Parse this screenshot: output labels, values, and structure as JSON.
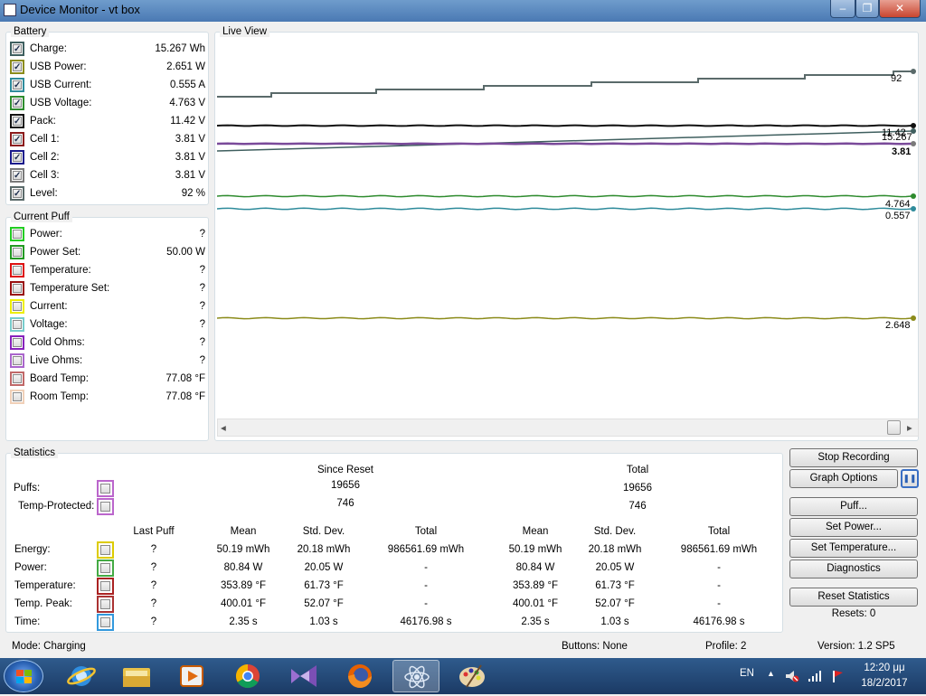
{
  "window": {
    "title": "Device Monitor - vt box",
    "min_icon": "–",
    "max_icon": "❐",
    "close_icon": "✕"
  },
  "battery": {
    "title": "Battery",
    "rows": [
      {
        "label": "Charge:",
        "value": "15.267 Wh",
        "color": "#3f5f5f",
        "checked": true
      },
      {
        "label": "USB Power:",
        "value": "2.651 W",
        "color": "#8b8b1a",
        "checked": true
      },
      {
        "label": "USB Current:",
        "value": "0.555 A",
        "color": "#2e8b9b",
        "checked": true
      },
      {
        "label": "USB Voltage:",
        "value": "4.763 V",
        "color": "#2e8b2e",
        "checked": true
      },
      {
        "label": "Pack:",
        "value": "11.42 V",
        "color": "#111111",
        "checked": true
      },
      {
        "label": "Cell 1:",
        "value": "3.81 V",
        "color": "#8b1a1a",
        "checked": true
      },
      {
        "label": "Cell 2:",
        "value": "3.81 V",
        "color": "#1a1a8b",
        "checked": true
      },
      {
        "label": "Cell 3:",
        "value": "3.81 V",
        "color": "#7a7a7a",
        "checked": true
      },
      {
        "label": "Level:",
        "value": "92 %",
        "color": "#5a6a6a",
        "checked": true
      }
    ]
  },
  "puff": {
    "title": "Current Puff",
    "rows": [
      {
        "label": "Power:",
        "value": "?",
        "color": "#22cc22",
        "checked": false
      },
      {
        "label": "Power Set:",
        "value": "50.00 W",
        "color": "#229922",
        "checked": false
      },
      {
        "label": "Temperature:",
        "value": "?",
        "color": "#dd1111",
        "checked": false
      },
      {
        "label": "Temperature Set:",
        "value": "?",
        "color": "#991111",
        "checked": false
      },
      {
        "label": "Current:",
        "value": "?",
        "color": "#eeee00",
        "checked": false
      },
      {
        "label": "Voltage:",
        "value": "?",
        "color": "#77cccc",
        "checked": false
      },
      {
        "label": "Cold Ohms:",
        "value": "?",
        "color": "#8822bb",
        "checked": false
      },
      {
        "label": "Live Ohms:",
        "value": "?",
        "color": "#aa66cc",
        "checked": false
      },
      {
        "label": "Board Temp:",
        "value": "77.08 °F",
        "color": "#c06868",
        "checked": false
      },
      {
        "label": "Room Temp:",
        "value": "77.08 °F",
        "color": "#f0d0b8",
        "checked": false
      }
    ]
  },
  "live_view": {
    "title": "Live View",
    "scroll_left": "◂",
    "scroll_right": "▸",
    "labels": [
      "92",
      "11.42",
      "15.267",
      "3.81",
      "4.764",
      "0.557",
      "2.648"
    ]
  },
  "statistics": {
    "title": "Statistics",
    "since_reset": "Since Reset",
    "total": "Total",
    "puffs_label": "Puffs:",
    "puffs_color": "#bb66cc",
    "puffs_since": "19656",
    "puffs_total": "19656",
    "temp_label": "Temp-Protected:",
    "temp_color": "#bb66cc",
    "temp_since": "746",
    "temp_total": "746",
    "columns": [
      "Last Puff",
      "Mean",
      "Std. Dev.",
      "Total",
      "Mean",
      "Std. Dev.",
      "Total"
    ],
    "rows": [
      {
        "label": "Energy:",
        "color": "#ddcc00",
        "cells": [
          "?",
          "50.19 mWh",
          "20.18 mWh",
          "986561.69 mWh",
          "50.19 mWh",
          "20.18 mWh",
          "986561.69 mWh"
        ]
      },
      {
        "label": "Power:",
        "color": "#44aa44",
        "cells": [
          "?",
          "80.84 W",
          "20.05 W",
          "-",
          "80.84 W",
          "20.05 W",
          "-"
        ]
      },
      {
        "label": "Temperature:",
        "color": "#aa2222",
        "cells": [
          "?",
          "353.89 °F",
          "61.73 °F",
          "-",
          "353.89 °F",
          "61.73 °F",
          "-"
        ]
      },
      {
        "label": "Temp. Peak:",
        "color": "#aa3333",
        "cells": [
          "?",
          "400.01 °F",
          "52.07 °F",
          "-",
          "400.01 °F",
          "52.07 °F",
          "-"
        ]
      },
      {
        "label": "Time:",
        "color": "#3399dd",
        "cells": [
          "?",
          "2.35 s",
          "1.03 s",
          "46176.98 s",
          "2.35 s",
          "1.03 s",
          "46176.98 s"
        ]
      }
    ]
  },
  "buttons": {
    "stop_recording": "Stop Recording",
    "graph_options": "Graph Options",
    "pause_icon": "❚❚",
    "puff": "Puff...",
    "set_power": "Set Power...",
    "set_temperature": "Set Temperature...",
    "diagnostics": "Diagnostics",
    "reset_statistics": "Reset Statistics",
    "resets": "Resets: 0"
  },
  "status": {
    "mode": "Mode: Charging",
    "buttons": "Buttons: None",
    "profile": "Profile: 2",
    "version": "Version: 1.2 SP5"
  },
  "taskbar": {
    "lang": "EN",
    "time": "12:20 μμ",
    "date": "18/2/2017",
    "tray_arrow": "▲"
  }
}
